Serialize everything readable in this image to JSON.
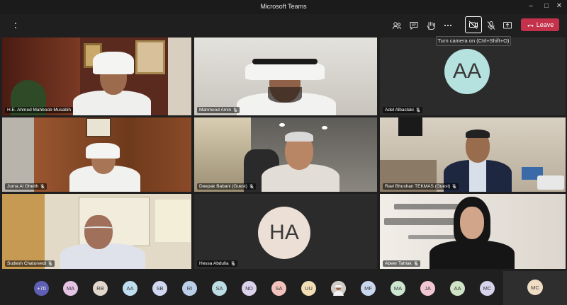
{
  "window": {
    "title": "Microsoft Teams"
  },
  "toolbar": {
    "leave_label": "Leave",
    "tooltip": "Turn camera on (Ctrl+Shift+O)"
  },
  "tiles": [
    {
      "name": "H.E. Ahmed Mahboob Musabih",
      "type": "video"
    },
    {
      "name": "Mahmood Amin",
      "type": "video"
    },
    {
      "name": "Adel Albastaki",
      "type": "avatar",
      "initials": "AA",
      "color": "#b5e1df"
    },
    {
      "name": "Juma Al Gheith",
      "type": "video"
    },
    {
      "name": "Deepak Babani (Guest)",
      "type": "video"
    },
    {
      "name": "Ravi Bhushan TEKMAS (Guest)",
      "type": "video"
    },
    {
      "name": "Sudesh Chaturvedi",
      "type": "video"
    },
    {
      "name": "Hessa Abdulla",
      "type": "avatar",
      "initials": "HA",
      "color": "#ecdfd5"
    },
    {
      "name": "Abeer Tahlak",
      "type": "video"
    }
  ],
  "strip": {
    "overflow": "+70",
    "participants": [
      {
        "initials": "MA",
        "color": "#e4c3e4"
      },
      {
        "initials": "RB",
        "color": "#e3d7cd"
      },
      {
        "initials": "AA",
        "color": "#bfdff0"
      },
      {
        "initials": "SB",
        "color": "#cfd8f0"
      },
      {
        "initials": "RI",
        "color": "#bccfe8"
      },
      {
        "initials": "SA",
        "color": "#bcdde3"
      },
      {
        "initials": "ND",
        "color": "#dcd2ec"
      },
      {
        "initials": "SA",
        "color": "#f3c2bd"
      },
      {
        "initials": "UU",
        "color": "#f3dfb6"
      },
      {
        "initials": "",
        "color": "#d8d8d8",
        "photo": true
      },
      {
        "initials": "MF",
        "color": "#c9d7ef"
      },
      {
        "initials": "MA",
        "color": "#cde6d0"
      },
      {
        "initials": "JA",
        "color": "#f1c7d4"
      },
      {
        "initials": "AA",
        "color": "#cfe4c4"
      },
      {
        "initials": "MC",
        "color": "#d7d3ec"
      }
    ],
    "self_initials": "MC",
    "self_color": "#efdcc2"
  }
}
